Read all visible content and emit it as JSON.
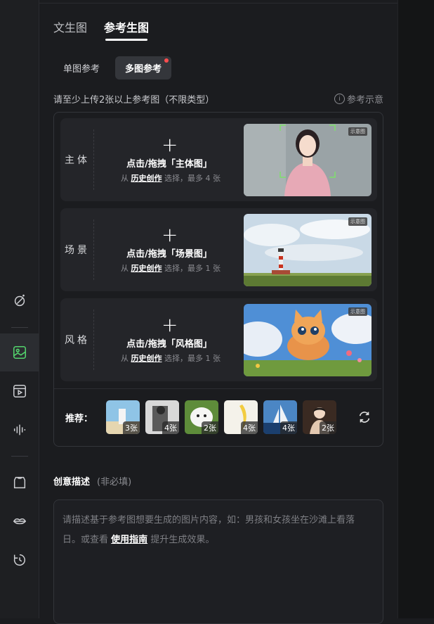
{
  "tabs": [
    {
      "label": "文生图"
    },
    {
      "label": "参考生图"
    }
  ],
  "modes": [
    {
      "label": "单图参考"
    },
    {
      "label": "多图参考"
    }
  ],
  "upload_hint": "请至少上传2张以上参考图（不限类型）",
  "ref_example": "参考示意",
  "cards": [
    {
      "label": "主体",
      "upload": "点击/拖拽「主体图」",
      "from": "从",
      "history": "历史创作",
      "limit": "选择，最多 4 张",
      "tag": "示意图"
    },
    {
      "label": "场景",
      "upload": "点击/拖拽「场景图」",
      "from": "从",
      "history": "历史创作",
      "limit": "选择，最多 1 张",
      "tag": "示意图"
    },
    {
      "label": "风格",
      "upload": "点击/拖拽「风格图」",
      "from": "从",
      "history": "历史创作",
      "limit": "选择，最多 1 张",
      "tag": "示意图"
    }
  ],
  "recommend": {
    "label": "推荐：",
    "items": [
      {
        "count": "3张",
        "color": "#8fb8d8"
      },
      {
        "count": "4张",
        "color": "#8a8a8a"
      },
      {
        "count": "2张",
        "color": "#e9eef2"
      },
      {
        "count": "4张",
        "color": "#f0e6b8"
      },
      {
        "count": "4张",
        "color": "#3a6ea8"
      },
      {
        "count": "2张",
        "color": "#b58a72"
      }
    ]
  },
  "description": {
    "title": "创意描述",
    "optional": "(非必填)",
    "placeholder_a": "请描述基于参考图想要生成的图片内容，如：男孩和女孩坐在沙滩上看落日。或查看",
    "guide_link": "使用指南",
    "placeholder_b": "提升生成效果。"
  },
  "rail_icons": [
    "magic-icon",
    "image-icon",
    "video-icon",
    "audio-icon",
    "avatar-icon",
    "lips-icon",
    "history-icon"
  ],
  "colors": {
    "accent": "#53d36c",
    "bg": "#1b1c1f",
    "dot": "#ff4d4f"
  }
}
